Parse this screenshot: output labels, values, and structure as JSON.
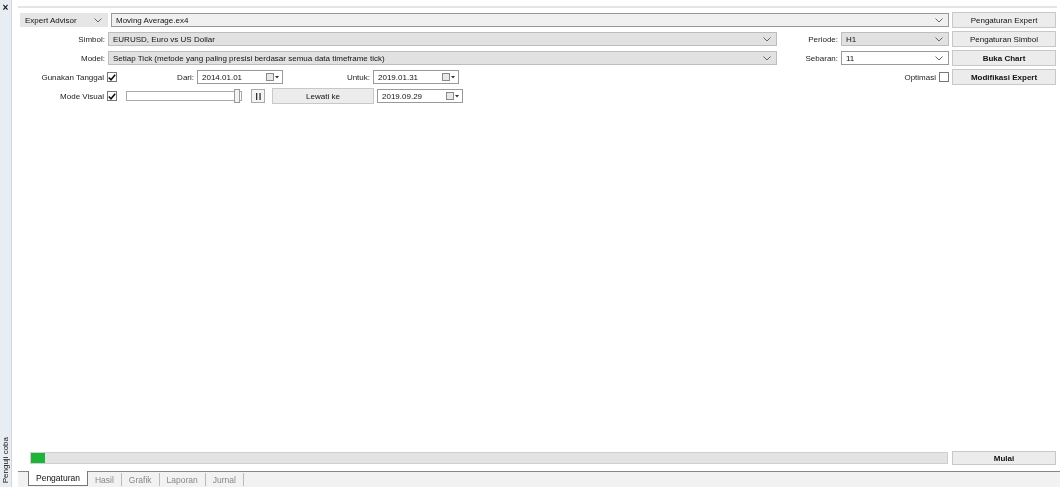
{
  "side_panel": {
    "close_glyph": "×",
    "title": "Penguji coba"
  },
  "expert": {
    "type_select": "Expert Advisor",
    "file": "Moving Average.ex4"
  },
  "symbol": {
    "label": "Simbol:",
    "value": "EURUSD, Euro vs US Dollar"
  },
  "model": {
    "label": "Model:",
    "value": "Setiap Tick (metode yang paling presisi berdasar semua data timeframe tick)"
  },
  "period": {
    "label": "Periode:",
    "value": "H1"
  },
  "spread": {
    "label": "Sebaran:",
    "value": "11"
  },
  "use_date": {
    "label": "Gunakan Tanggal",
    "checked": true
  },
  "from": {
    "label": "Dari:",
    "value": "2014.01.01"
  },
  "to": {
    "label": "Untuk:",
    "value": "2019.01.31"
  },
  "optimization": {
    "label": "Optimasi",
    "checked": false
  },
  "visual_mode": {
    "label": "Mode Visual",
    "checked": true,
    "speed": {
      "level": 0.97
    },
    "skip_button": "Lewati ke",
    "skip_date": "2019.09.29"
  },
  "buttons": [
    "Pengaturan Expert",
    "Pengaturan Simbol",
    "Buka Chart",
    "Modifikasi Expert"
  ],
  "progress": {
    "level": 0.015
  },
  "start_button": "Mulai",
  "tabs": [
    {
      "label": "Pengaturan",
      "selected": true
    },
    {
      "label": "Hasil",
      "selected": false
    },
    {
      "label": "Grafik",
      "selected": false
    },
    {
      "label": "Laporan",
      "selected": false
    },
    {
      "label": "Jurnal",
      "selected": false
    }
  ]
}
